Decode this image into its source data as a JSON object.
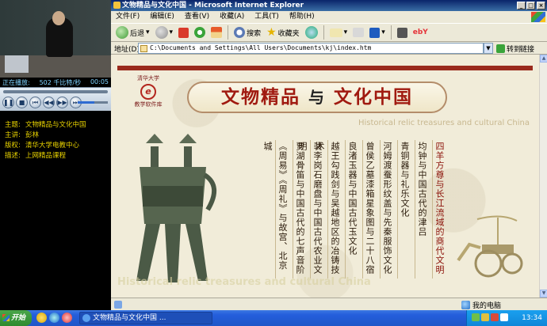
{
  "player": {
    "status_label": "正在播放:",
    "status_rate": "502 千比特/秒",
    "status_time": "00:05",
    "buttons": [
      "pause",
      "stop",
      "previous",
      "rewind",
      "fast-forward",
      "next",
      "mute"
    ],
    "seek_progress_percent": 0,
    "volume_percent": 55
  },
  "info": {
    "rows": [
      {
        "key": "主题:",
        "value": "文物精品与文化中国"
      },
      {
        "key": "主讲:",
        "value": "彭林"
      },
      {
        "key": "版权:",
        "value": "清华大学电教中心"
      },
      {
        "key": "描述:",
        "value": "上网精品课程"
      }
    ]
  },
  "window": {
    "title": "文物精品与文化中国 - Microsoft Internet Explorer",
    "controls": [
      "_",
      "□",
      "×"
    ]
  },
  "menu": [
    "文件(F)",
    "编辑(E)",
    "查看(V)",
    "收藏(A)",
    "工具(T)",
    "帮助(H)"
  ],
  "toolbar": {
    "back": "后退",
    "search": "搜索",
    "favorites": "收藏夹"
  },
  "address": {
    "label": "地址(D)",
    "value": "C:\\Documents and Settings\\All Users\\Documents\\kj\\index.htm",
    "go": "转到",
    "links": "链接"
  },
  "page": {
    "logo_top": "清华大学",
    "logo_mark": "e",
    "logo_bottom": "教学软件库",
    "banner_left": "文物精品",
    "banner_mid": "与",
    "banner_right": "文化中国",
    "subtitle_en": "Historical relic treasures and cultural China",
    "watermark": "Historical relic treasures and cultural China",
    "columns": [
      "四羊方尊与长江流域的商代文明",
      "均钟与中国古代的津吕",
      "青铜器与礼乐文化",
      "河姆渡蚕形纹盖与先秦服饰文化",
      "曾侯乙墓漆箱星象图与二十八宿",
      "良渚玉器与中国古代玉文化",
      "越王勾践剑与吴越地区的冶铸技术",
      "裴李岗石磨盘与中国古代农业文明",
      "贾湖骨笛与中国古代的七声音阶",
      "《周易》《周礼》与故宫、北京城"
    ],
    "highlight_columns": [
      0
    ]
  },
  "statusbar": {
    "zone": "我的电脑"
  },
  "taskbar": {
    "start": "开始",
    "task_ie": "文物精品与文化中国 ...",
    "clock": "13:34"
  },
  "colors": {
    "banner_red": "#a01a10",
    "info_yellow": "#e8d200",
    "taskbar_blue": "#245edb",
    "start_green": "#2e8a2e"
  }
}
